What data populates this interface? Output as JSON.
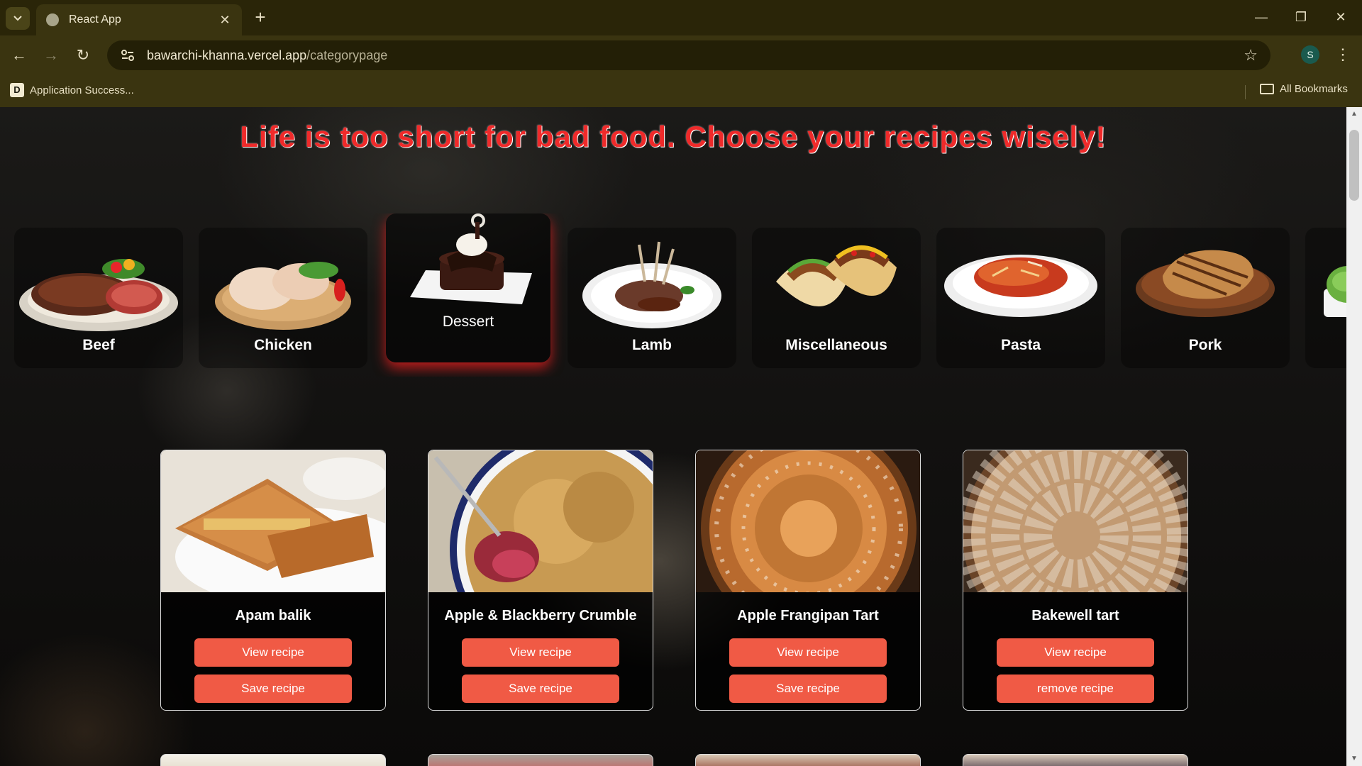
{
  "browser": {
    "tab_title": "React App",
    "url_host": "bawarchi-khanna.vercel.app",
    "url_path": "/categorypage",
    "profile_initial": "S",
    "bookmark_item": "Application Success...",
    "bookmark_item_icon": "D",
    "all_bookmarks": "All Bookmarks"
  },
  "page": {
    "headline": "Life is too short for bad food. Choose your recipes wisely!",
    "accent_color": "#ef2a2a",
    "button_color": "#f05a45"
  },
  "categories": [
    {
      "label": "Beef",
      "active": false
    },
    {
      "label": "Chicken",
      "active": false
    },
    {
      "label": "Dessert",
      "active": true
    },
    {
      "label": "Lamb",
      "active": false
    },
    {
      "label": "Miscellaneous",
      "active": false
    },
    {
      "label": "Pasta",
      "active": false
    },
    {
      "label": "Pork",
      "active": false
    }
  ],
  "recipes": [
    {
      "name": "Apam balik",
      "view_label": "View recipe",
      "action_label": "Save recipe"
    },
    {
      "name": "Apple & Blackberry Crumble",
      "view_label": "View recipe",
      "action_label": "Save recipe"
    },
    {
      "name": "Apple Frangipan Tart",
      "view_label": "View recipe",
      "action_label": "Save recipe"
    },
    {
      "name": "Bakewell tart",
      "view_label": "View recipe",
      "action_label": "remove recipe"
    }
  ]
}
